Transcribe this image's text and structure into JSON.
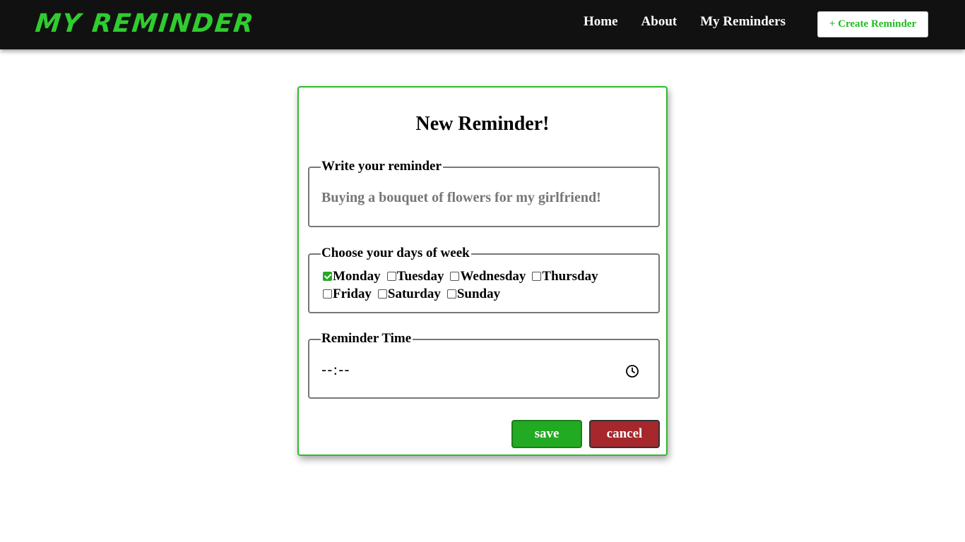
{
  "nav": {
    "brand": "MY REMINDER",
    "links": [
      "Home",
      "About",
      "My Reminders"
    ],
    "create_label": "+ Create Reminder"
  },
  "form": {
    "title": "New Reminder!",
    "reminder": {
      "legend": "Write your reminder",
      "value": "Buying a bouquet of flowers for my girlfriend!"
    },
    "days": {
      "legend": "Choose your days of week",
      "items": [
        {
          "label": "Monday",
          "checked": true
        },
        {
          "label": "Tuesday",
          "checked": false
        },
        {
          "label": "Wednesday",
          "checked": false
        },
        {
          "label": "Thursday",
          "checked": false
        },
        {
          "label": "Friday",
          "checked": false
        },
        {
          "label": "Saturday",
          "checked": false
        },
        {
          "label": "Sunday",
          "checked": false
        }
      ]
    },
    "time": {
      "legend": "Reminder Time",
      "value": "--:--",
      "icon": "clock-icon"
    },
    "save_label": "save",
    "cancel_label": "cancel"
  },
  "colors": {
    "brand": "#2fcc2f",
    "nav_bg": "#111111",
    "save": "#22aa22",
    "cancel": "#a6282c",
    "card_border": "#2fbb2f"
  }
}
